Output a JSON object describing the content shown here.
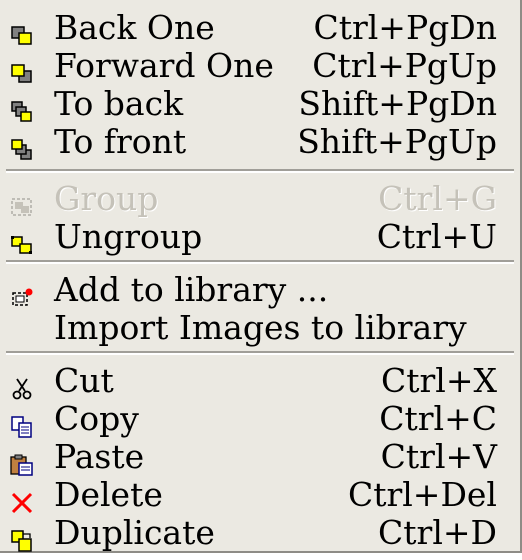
{
  "menu": {
    "items": [
      {
        "label": "Back One",
        "shortcut": "Ctrl+PgDn",
        "icon": "back-one-icon"
      },
      {
        "label": "Forward One",
        "shortcut": "Ctrl+PgUp",
        "icon": "forward-one-icon"
      },
      {
        "label": "To back",
        "shortcut": "Shift+PgDn",
        "icon": "to-back-icon"
      },
      {
        "label": "To front",
        "shortcut": "Shift+PgUp",
        "icon": "to-front-icon"
      },
      {
        "label": "Group",
        "shortcut": "Ctrl+G",
        "icon": "group-icon",
        "disabled": true
      },
      {
        "label": "Ungroup",
        "shortcut": "Ctrl+U",
        "icon": "ungroup-icon"
      },
      {
        "label": "Add to library ...",
        "shortcut": "",
        "icon": "add-to-library-icon"
      },
      {
        "label": "Import Images to library",
        "shortcut": "",
        "icon": ""
      },
      {
        "label": "Cut",
        "shortcut": "Ctrl+X",
        "icon": "scissors-icon"
      },
      {
        "label": "Copy",
        "shortcut": "Ctrl+C",
        "icon": "copy-icon"
      },
      {
        "label": "Paste",
        "shortcut": "Ctrl+V",
        "icon": "paste-icon"
      },
      {
        "label": "Delete",
        "shortcut": "Ctrl+Del",
        "icon": "delete-icon"
      },
      {
        "label": "Duplicate",
        "shortcut": "Ctrl+D",
        "icon": "duplicate-icon"
      }
    ]
  }
}
